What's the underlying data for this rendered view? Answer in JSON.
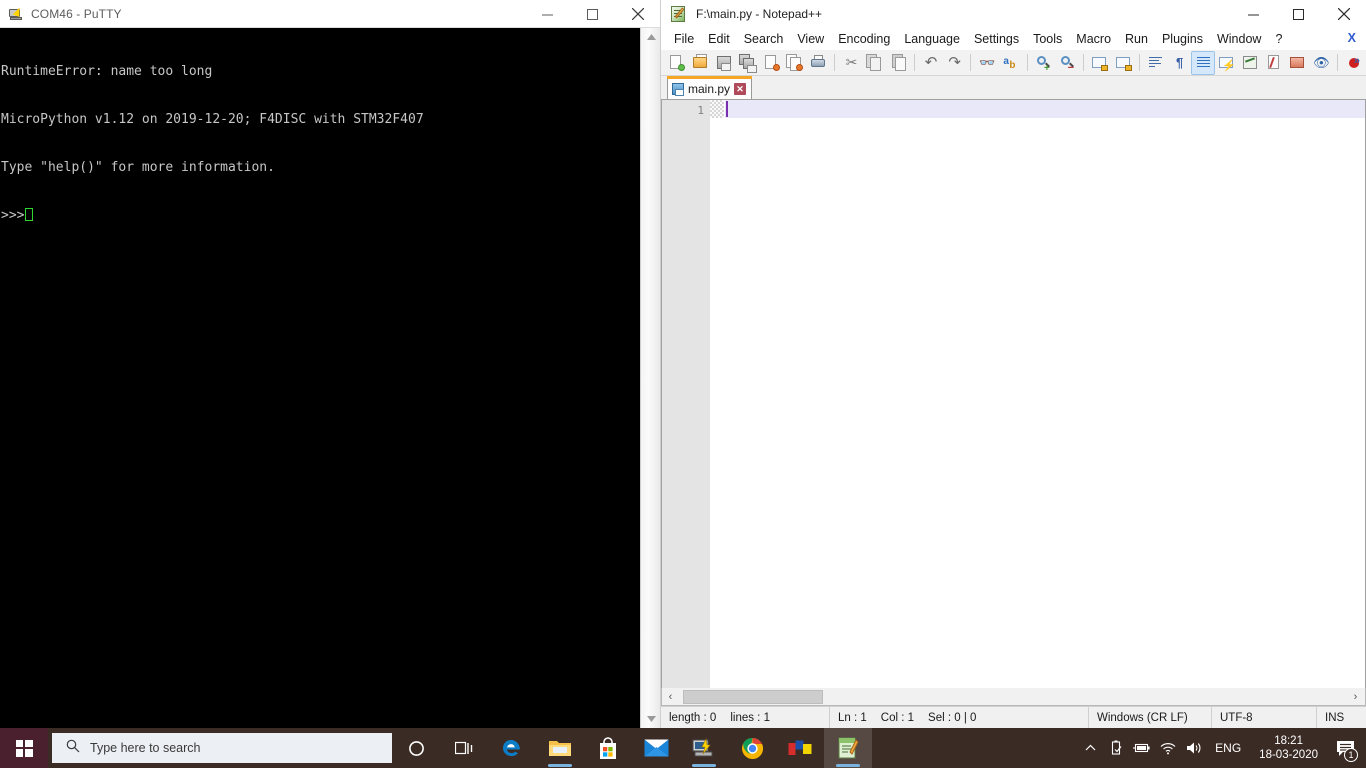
{
  "putty": {
    "title": "COM46 - PuTTY",
    "icon": "putty-icon",
    "window_buttons": {
      "minimize": "minimize-icon",
      "maximize": "maximize-icon",
      "close": "close-icon"
    },
    "terminal_lines": [
      "RuntimeError: name too long",
      "MicroPython v1.12 on 2019-12-20; F4DISC with STM32F407",
      "Type \"help()\" for more information.",
      ">>> "
    ],
    "prompt": ">>>",
    "colors": {
      "background": "#000000",
      "text": "#c6c6c6",
      "cursor": "#2fd72f"
    }
  },
  "notepadpp": {
    "title": "F:\\main.py - Notepad++",
    "icon": "notepad-plus-plus-icon",
    "window_buttons": {
      "minimize": "minimize-icon",
      "maximize": "maximize-icon",
      "close": "close-icon"
    },
    "menu": [
      "File",
      "Edit",
      "Search",
      "View",
      "Encoding",
      "Language",
      "Settings",
      "Tools",
      "Macro",
      "Run",
      "Plugins",
      "Window",
      "?"
    ],
    "menu_close_label": "X",
    "toolbar": [
      {
        "name": "new-file-icon",
        "tip": "New"
      },
      {
        "name": "open-file-icon",
        "tip": "Open"
      },
      {
        "name": "save-icon",
        "tip": "Save"
      },
      {
        "name": "save-all-icon",
        "tip": "Save All"
      },
      {
        "name": "close-file-icon",
        "tip": "Close"
      },
      {
        "name": "close-all-icon",
        "tip": "Close All"
      },
      {
        "name": "print-icon",
        "tip": "Print"
      },
      {
        "name": "cut-icon",
        "tip": "Cut"
      },
      {
        "name": "copy-icon",
        "tip": "Copy"
      },
      {
        "name": "paste-icon",
        "tip": "Paste"
      },
      {
        "name": "undo-icon",
        "tip": "Undo"
      },
      {
        "name": "redo-icon",
        "tip": "Redo"
      },
      {
        "name": "find-icon",
        "tip": "Find"
      },
      {
        "name": "replace-icon",
        "tip": "Replace"
      },
      {
        "name": "zoom-in-icon",
        "tip": "Zoom In"
      },
      {
        "name": "zoom-out-icon",
        "tip": "Zoom Out"
      },
      {
        "name": "sync-vertical-scroll-icon",
        "tip": "Synchronize Vertical Scrolling"
      },
      {
        "name": "sync-horizontal-scroll-icon",
        "tip": "Synchronize Horizontal Scrolling"
      },
      {
        "name": "word-wrap-icon",
        "tip": "Word wrap"
      },
      {
        "name": "show-all-characters-icon",
        "tip": "Show All Characters"
      },
      {
        "name": "indent-guide-icon",
        "tip": "Show Indent Guide"
      },
      {
        "name": "user-defined-dialog-icon",
        "tip": "User-Defined Dialogue"
      },
      {
        "name": "document-map-icon",
        "tip": "Document Map"
      },
      {
        "name": "function-list-icon",
        "tip": "Function List"
      },
      {
        "name": "folder-as-workspace-icon",
        "tip": "Folder as Workspace"
      },
      {
        "name": "monitoring-icon",
        "tip": "Monitoring"
      },
      {
        "name": "record-macro-icon",
        "tip": "Start Recording"
      }
    ],
    "toolbar_overflow": "»",
    "tabs": [
      {
        "label": "main.py",
        "close": "✕",
        "active": true
      }
    ],
    "editor": {
      "line_numbers": [
        "1"
      ],
      "content": "",
      "caret_line": 1,
      "caret_column": 1
    },
    "hscroll": {
      "left_arrow": "‹",
      "right_arrow": "›"
    },
    "statusbar": {
      "length": "length : 0",
      "lines": "lines : 1",
      "ln": "Ln : 1",
      "col": "Col : 1",
      "sel": "Sel : 0 | 0",
      "eol": "Windows (CR LF)",
      "encoding": "UTF-8",
      "mode": "INS"
    }
  },
  "taskbar": {
    "start": "windows-start-icon",
    "search": {
      "placeholder": "Type here to search",
      "icon": "search-icon"
    },
    "cortana": "cortana-icon",
    "task_view": "task-view-icon",
    "apps": [
      {
        "name": "microsoft-edge-icon",
        "active": false
      },
      {
        "name": "file-explorer-icon",
        "active": true
      },
      {
        "name": "microsoft-store-icon",
        "active": false
      },
      {
        "name": "mail-icon",
        "active": false
      },
      {
        "name": "putty-icon",
        "active": true
      },
      {
        "name": "google-chrome-icon",
        "active": false
      },
      {
        "name": "colored-blocks-app-icon",
        "active": false
      },
      {
        "name": "notepad-plus-plus-icon",
        "active": true
      }
    ],
    "tray": {
      "show_hidden_icons": "chevron-up-icon",
      "safely_remove_hardware": "usb-eject-icon",
      "battery": "battery-icon",
      "network": "wifi-icon",
      "volume": "speaker-icon",
      "language": "ENG",
      "time": "18:21",
      "date": "18-03-2020",
      "notifications": "action-center-icon",
      "notification_count": "1"
    },
    "color": "#3b2b25"
  }
}
